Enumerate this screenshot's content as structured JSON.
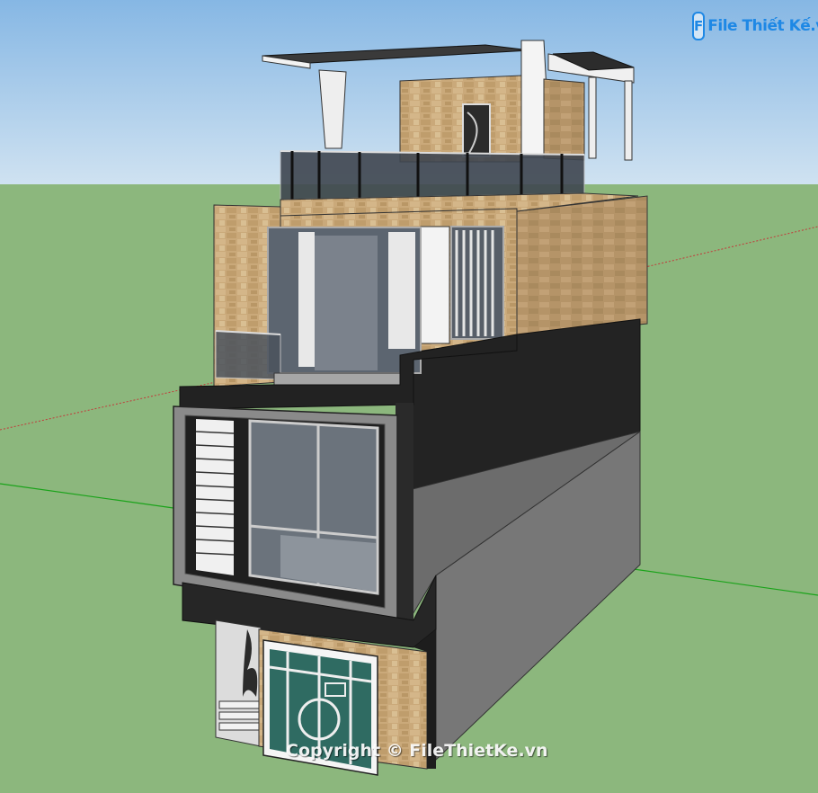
{
  "logo": {
    "mark": "F",
    "text": "File Thiết Kế.vn"
  },
  "watermark": {
    "text": "Copyright © FileThietKe.vn"
  },
  "colors": {
    "sky": "#a9cbe9",
    "ground": "#8cb77d",
    "stone": "#c9ac7c",
    "dark": "#262626",
    "grey": "#7a7a7a",
    "glass": "#5a6470",
    "frame": "#a9a9a9",
    "axis_red": "#c23a3a",
    "axis_green": "#1aa31a"
  }
}
